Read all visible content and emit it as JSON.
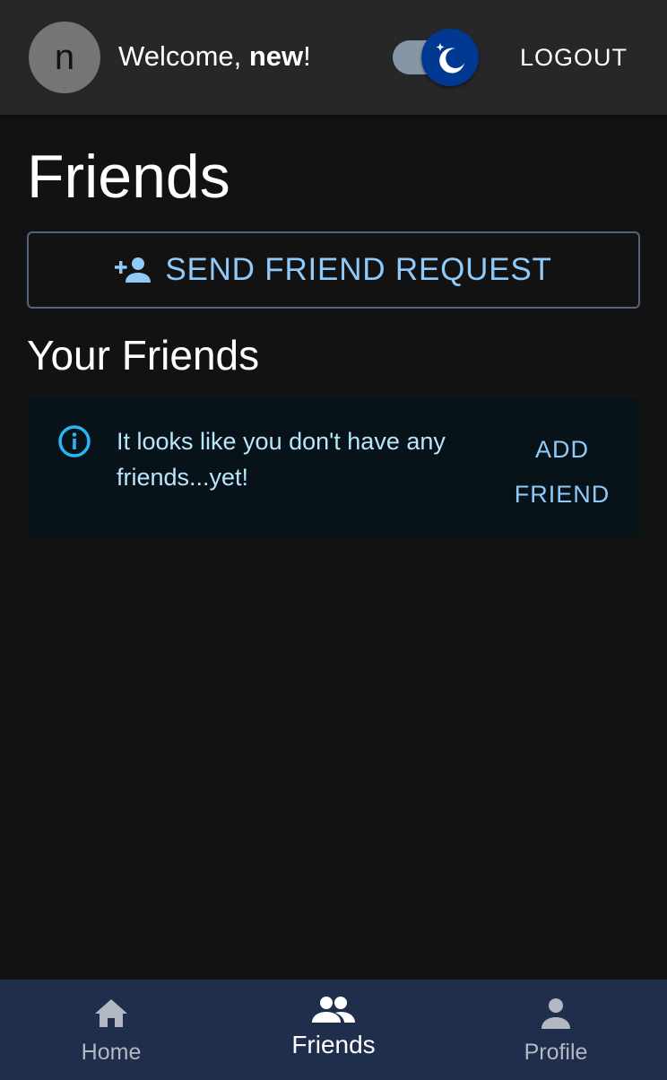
{
  "header": {
    "avatar_initial": "n",
    "welcome_prefix": "Welcome, ",
    "username": "new",
    "welcome_suffix": "!",
    "theme_toggle_state": "dark",
    "logout_label": "LOGOUT"
  },
  "page": {
    "title": "Friends",
    "send_request_label": "SEND FRIEND REQUEST",
    "section_title": "Your Friends"
  },
  "alert": {
    "message": "It looks like you don't have any friends...yet!",
    "action_label": "ADD FRIEND"
  },
  "bottom_nav": {
    "items": [
      {
        "label": "Home",
        "icon": "home-icon",
        "active": false
      },
      {
        "label": "Friends",
        "icon": "friends-icon",
        "active": true
      },
      {
        "label": "Profile",
        "icon": "person-icon",
        "active": false
      }
    ]
  },
  "colors": {
    "background": "#121212",
    "appbar": "#272727",
    "accent": "#90caf9",
    "alert_background": "#071219",
    "bottom_nav": "#1e2e4b"
  }
}
